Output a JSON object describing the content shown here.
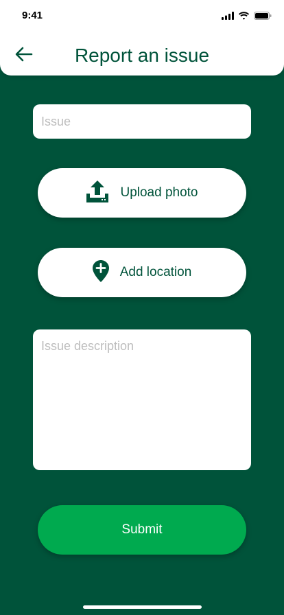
{
  "status_bar": {
    "time": "9:41",
    "icons": [
      "cellular-signal-icon",
      "wifi-icon",
      "battery-icon"
    ]
  },
  "header": {
    "title": "Report an issue",
    "back_icon": "arrow-left-icon"
  },
  "form": {
    "issue_placeholder": "Issue",
    "upload_label": "Upload photo",
    "upload_icon": "upload-tray-icon",
    "location_label": "Add location",
    "location_icon": "map-pin-plus-icon",
    "description_placeholder": "Issue description",
    "submit_label": "Submit"
  },
  "colors": {
    "background": "#00533a",
    "primary_text": "#00533a",
    "submit": "#00aa4f",
    "surface": "#ffffff",
    "placeholder": "#bdbdbd"
  }
}
